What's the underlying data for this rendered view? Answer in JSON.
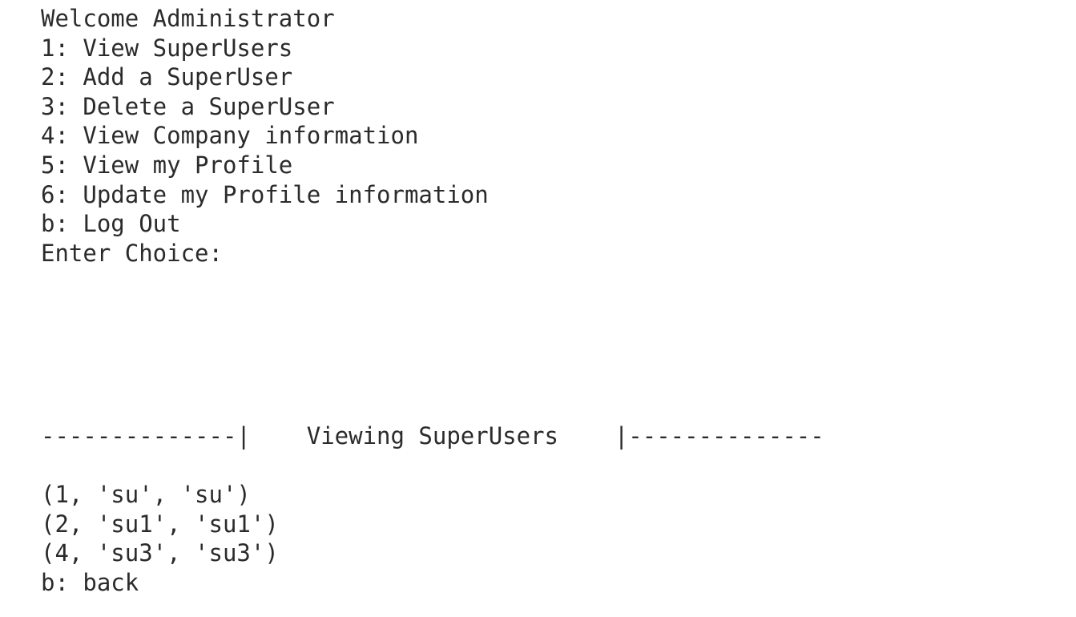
{
  "menu": {
    "welcome": "Welcome Administrator",
    "options": [
      "1: View SuperUsers",
      "2: Add a SuperUser",
      "3: Delete a SuperUser",
      "4: View Company information",
      "5: View my Profile",
      "6: Update my Profile information",
      "b: Log Out"
    ],
    "prompt": "Enter Choice:"
  },
  "superusers_view": {
    "header": "--------------|    Viewing SuperUsers    |--------------",
    "rows": [
      "(1, 'su', 'su')",
      "(2, 'su1', 'su1')",
      "(4, 'su3', 'su3')"
    ],
    "back": "b: back"
  }
}
